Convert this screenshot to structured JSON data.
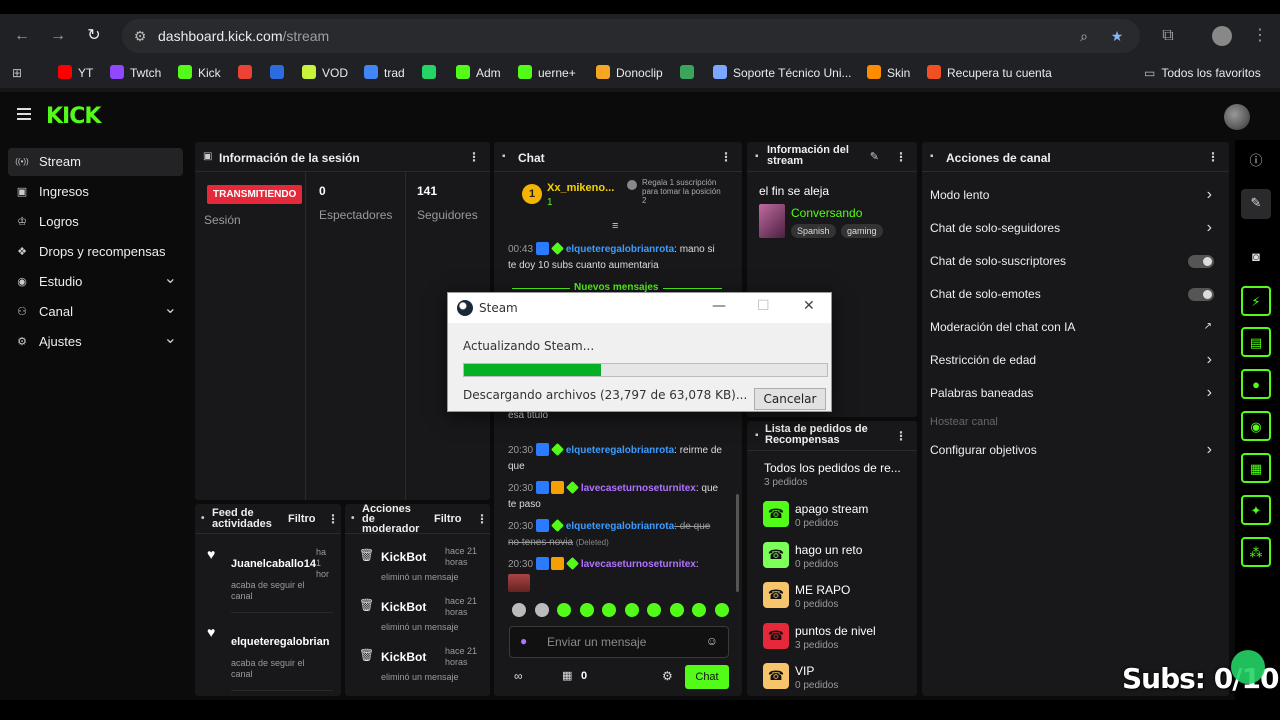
{
  "browser": {
    "url_host": "dashboard.kick.com",
    "url_path": "/stream",
    "bookmarks": [
      {
        "label": "YT",
        "color": "#ff0000"
      },
      {
        "label": "Twtch",
        "color": "#9146ff"
      },
      {
        "label": "Kick",
        "color": "#53fc18"
      },
      {
        "label": "",
        "color": "#ea4335"
      },
      {
        "label": "",
        "color": "#2d6cdf"
      },
      {
        "label": "VOD",
        "color": "#c9f23c"
      },
      {
        "label": "trad",
        "color": "#4285f4"
      },
      {
        "label": "",
        "color": "#25d366"
      },
      {
        "label": "Adm",
        "color": "#53fc18"
      },
      {
        "label": "uerne+",
        "color": "#53fc18"
      },
      {
        "label": "Donoclip",
        "color": "#f5a623"
      },
      {
        "label": "",
        "color": "#3ba55c"
      },
      {
        "label": "Soporte Técnico Uni...",
        "color": "#7aa7ff"
      },
      {
        "label": "Skin",
        "color": "#ff8c00"
      },
      {
        "label": "Recupera tu cuenta",
        "color": "#f25022"
      }
    ],
    "all_favorites": "Todos los favoritos"
  },
  "kick": {
    "logo": "KICK"
  },
  "sidebar": {
    "items": [
      {
        "label": "Stream",
        "icon": "broadcast-icon",
        "active": true
      },
      {
        "label": "Ingresos",
        "icon": "income-icon"
      },
      {
        "label": "Logros",
        "icon": "trophy-icon"
      },
      {
        "label": "Drops y recompensas",
        "icon": "gift-icon"
      },
      {
        "label": "Estudio",
        "icon": "studio-icon",
        "expandable": true
      },
      {
        "label": "Canal",
        "icon": "channel-icon",
        "expandable": true
      },
      {
        "label": "Ajustes",
        "icon": "gear-icon",
        "expandable": true
      }
    ]
  },
  "session": {
    "title": "Información de la sesión",
    "status": "TRANSMITIENDO",
    "session_label": "Sesión",
    "viewers": "0",
    "viewers_label": "Espectadores",
    "followers": "141",
    "followers_label": "Seguidores"
  },
  "chat": {
    "title": "Chat",
    "top_user": "Xx_mikeno...",
    "top_rank": "1",
    "top_count": "1",
    "gift_note": "Regala 1 suscripción para tomar la posición 2",
    "new_messages": "Nuevos mensajes",
    "messages": [
      {
        "time": "00:43",
        "user": "elqueteregalobrianrota",
        "text": ": mano si te doy 10 subs cuanto aumentaria"
      },
      {
        "time": "20:30",
        "user": "lavecaseturnoseturnitex",
        "text": ": y esa titulo"
      },
      {
        "time": "20:30",
        "user": "elqueteregalobrianrota",
        "text": ": reirme de que"
      },
      {
        "time": "20:30",
        "user": "lavecaseturnoseturnitex",
        "text": ": que te paso"
      },
      {
        "time": "20:30",
        "user": "elqueteregalobrianrota",
        "text": ": de que no tenes novia",
        "deleted": "(Deleted)"
      },
      {
        "time": "20:30",
        "user": "lavecaseturnoseturnitex",
        "text": ":"
      }
    ],
    "input_placeholder": "Enviar un mensaje",
    "points": "0",
    "send_label": "Chat"
  },
  "stream_info": {
    "title": "Información del stream",
    "stream_title": "el fin se aleja",
    "category": "Conversando",
    "tags": [
      "Spanish",
      "gaming"
    ]
  },
  "rewards": {
    "title": "Lista de pedidos de Recompensas",
    "all_label": "Todos los pedidos de re...",
    "all_count": "3 pedidos",
    "items": [
      {
        "name": "apago stream",
        "count": "0 pedidos",
        "color": "#53fc18"
      },
      {
        "name": "hago un reto",
        "count": "0 pedidos",
        "color": "#7dff5a"
      },
      {
        "name": "ME RAPO",
        "count": "0 pedidos",
        "color": "#f6c46b"
      },
      {
        "name": "puntos de nivel",
        "count": "3 pedidos",
        "color": "#e5293b"
      },
      {
        "name": "VIP",
        "count": "0 pedidos",
        "color": "#f6c46b"
      }
    ]
  },
  "actions": {
    "title": "Acciones de canal",
    "items": [
      {
        "label": "Modo lento",
        "control": "arrow"
      },
      {
        "label": "Chat de solo-seguidores",
        "control": "arrow"
      },
      {
        "label": "Chat de solo-suscriptores",
        "control": "toggle"
      },
      {
        "label": "Chat de solo-emotes",
        "control": "toggle"
      },
      {
        "label": "Moderación del chat con IA",
        "control": "external"
      },
      {
        "label": "Restricción de edad",
        "control": "arrow"
      },
      {
        "label": "Palabras baneadas",
        "control": "arrow"
      },
      {
        "label": "Hostear canal",
        "control": "none",
        "disabled": true
      },
      {
        "label": "Configurar objetivos",
        "control": "arrow"
      }
    ]
  },
  "activity": {
    "title": "Feed de actividades",
    "filter": "Filtro",
    "items": [
      {
        "user": "Juanelcaballo14",
        "time": "ha 1 hor",
        "text": "acaba de seguir el canal"
      },
      {
        "user": "elqueteregalobrian",
        "time": "",
        "text": "acaba de seguir el canal"
      }
    ]
  },
  "mod_actions": {
    "title": "Acciones de moderador",
    "filter": "Filtro",
    "items": [
      {
        "user": "KickBot",
        "time": "hace 21 horas",
        "text": "eliminó un mensaje"
      },
      {
        "user": "KickBot",
        "time": "hace 21 horas",
        "text": "eliminó un mensaje"
      },
      {
        "user": "KickBot",
        "time": "hace 21 horas",
        "text": "eliminó un mensaje"
      }
    ]
  },
  "steam": {
    "window_title": "Steam",
    "status": "Actualizando Steam...",
    "progress": 0.377,
    "download_text": "Descargando archivos (23,797 de 63,078 KB)...",
    "cancel_label": "Cancelar"
  },
  "overlay": {
    "subs_text": "Subs: 0/10"
  },
  "colors": {
    "kick_green": "#53fc18",
    "live_red": "#e5293b",
    "panel_bg": "#18181a"
  }
}
